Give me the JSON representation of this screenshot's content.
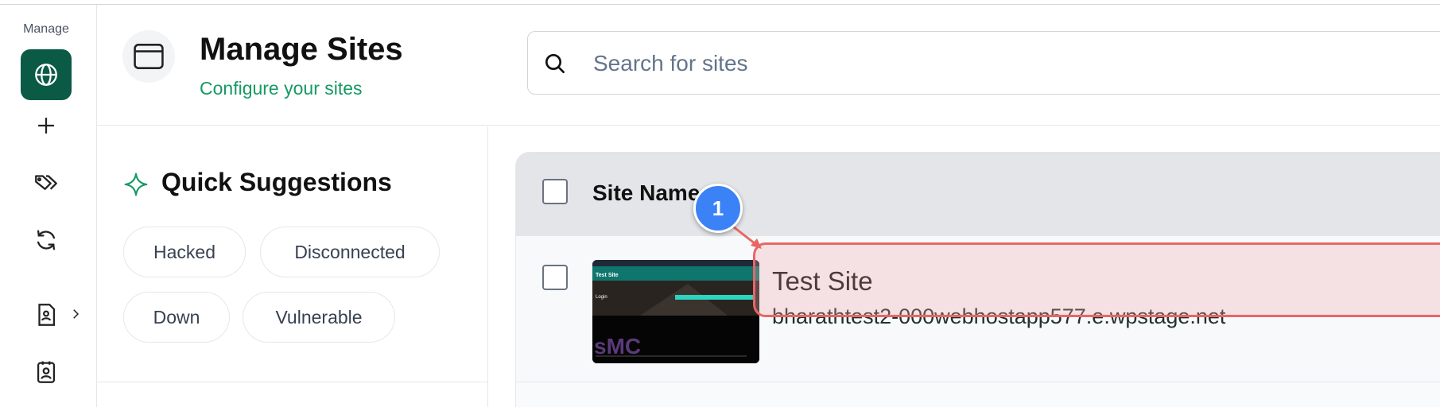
{
  "sidebar": {
    "section_label": "Manage",
    "items": [
      {
        "name": "sites",
        "icon": "globe-icon",
        "active": true
      },
      {
        "name": "add",
        "icon": "plus-icon"
      },
      {
        "name": "tags",
        "icon": "tags-icon"
      },
      {
        "name": "sync",
        "icon": "refresh-icon"
      },
      {
        "name": "reports",
        "icon": "report-icon",
        "has_submenu": true
      },
      {
        "name": "clients",
        "icon": "contact-icon"
      }
    ],
    "active_color": "#0b5a45"
  },
  "header": {
    "icon": "browser-window-icon",
    "title": "Manage Sites",
    "subtitle": "Configure your sites",
    "subtitle_color": "#159a63"
  },
  "search": {
    "placeholder": "Search for sites",
    "value": ""
  },
  "quick_suggestions": {
    "title": "Quick Suggestions",
    "chips": [
      "Hacked",
      "Disconnected",
      "Down",
      "Vulnerable"
    ]
  },
  "table": {
    "column_site_name": "Site Name",
    "rows": [
      {
        "name": "Test Site",
        "url": "bharathtest2-000webhostapp577.e.wpstage.net",
        "thumbnail": {
          "banner_text": "Test Site",
          "login_text": "Login",
          "logo_text": "sMC"
        }
      }
    ]
  },
  "annotation": {
    "step_number": "1",
    "badge_color": "#3b82f6",
    "highlight_color": "#e96666"
  }
}
